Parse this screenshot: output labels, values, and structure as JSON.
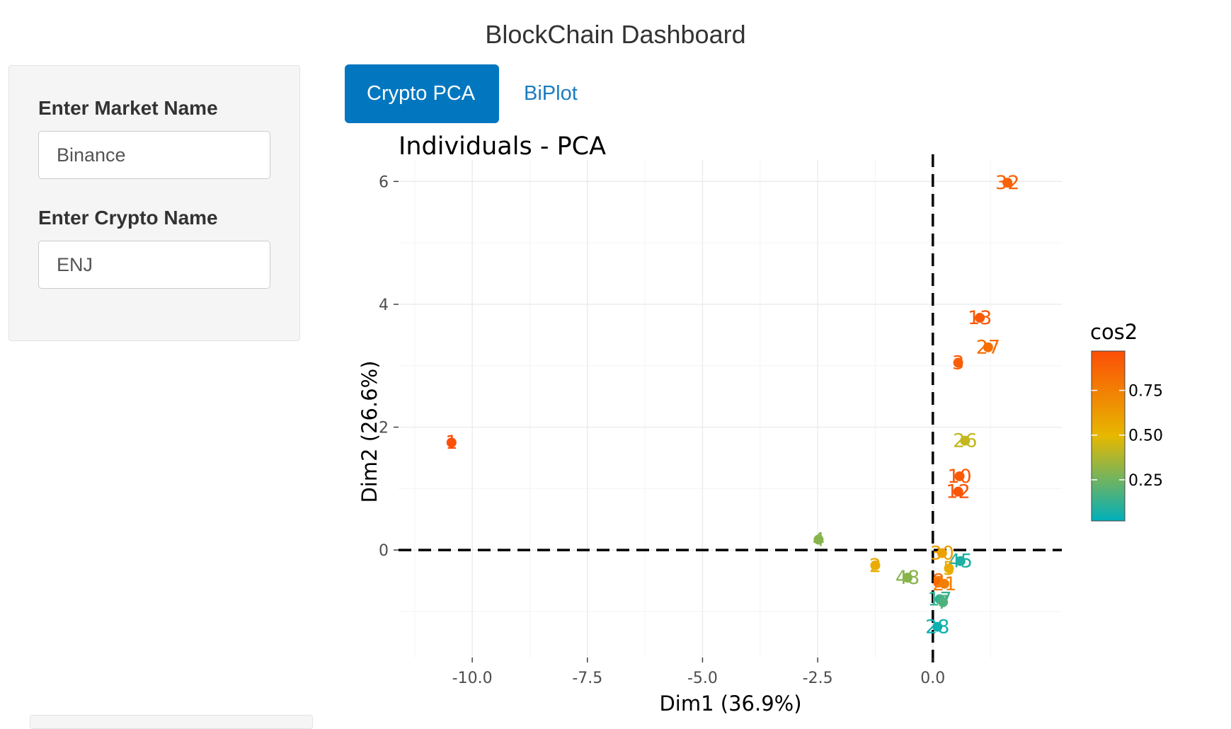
{
  "app": {
    "title": "BlockChain Dashboard"
  },
  "sidebar": {
    "market_label": "Enter Market Name",
    "market_value": "Binance",
    "crypto_label": "Enter Crypto Name",
    "crypto_value": "ENJ"
  },
  "tabs": [
    {
      "label": "Crypto PCA",
      "active": true
    },
    {
      "label": "BiPlot",
      "active": false
    }
  ],
  "chart_data": {
    "type": "scatter",
    "title": "Individuals - PCA",
    "xlabel": "Dim1 (36.9%)",
    "ylabel": "Dim2 (26.6%)",
    "xlim": [
      -11.6,
      2.8
    ],
    "ylim": [
      -1.75,
      6.35
    ],
    "xticks": [
      -10.0,
      -7.5,
      -5.0,
      -2.5,
      0.0
    ],
    "xtick_labels": [
      "-10.0",
      "-7.5",
      "-5.0",
      "-2.5",
      "0.0"
    ],
    "yticks": [
      0,
      2,
      4,
      6
    ],
    "ytick_labels": [
      "0",
      "2",
      "4",
      "6"
    ],
    "grid": true,
    "reference_lines": {
      "x": 0,
      "y": 0,
      "style": "dashed"
    },
    "legend": {
      "title": "cos2",
      "placement": "right",
      "tick_values": [
        0.25,
        0.5,
        0.75
      ],
      "tick_labels": [
        "0.25",
        "0.50",
        "0.75"
      ],
      "range": [
        0.02,
        0.97
      ],
      "colors": [
        "#00AFBB",
        "#E7B800",
        "#FC4E07"
      ]
    },
    "points": [
      {
        "label": "32",
        "x": 1.62,
        "y": 5.98,
        "cos2": 0.88
      },
      {
        "label": "13",
        "x": 1.02,
        "y": 3.78,
        "cos2": 0.93
      },
      {
        "label": "27",
        "x": 1.2,
        "y": 3.3,
        "cos2": 0.82
      },
      {
        "label": "3",
        "x": 0.55,
        "y": 3.05,
        "cos2": 0.9
      },
      {
        "label": "26",
        "x": 0.7,
        "y": 1.78,
        "cos2": 0.42
      },
      {
        "label": "10",
        "x": 0.58,
        "y": 1.2,
        "cos2": 0.92
      },
      {
        "label": "12",
        "x": 0.55,
        "y": 0.95,
        "cos2": 0.94
      },
      {
        "label": "1",
        "x": -10.45,
        "y": 1.75,
        "cos2": 0.96
      },
      {
        "label": "4",
        "x": -2.48,
        "y": 0.17,
        "cos2": 0.3
      },
      {
        "label": "2",
        "x": -1.25,
        "y": -0.25,
        "cos2": 0.55
      },
      {
        "label": "48",
        "x": -0.55,
        "y": -0.45,
        "cos2": 0.3
      },
      {
        "label": "30",
        "x": 0.2,
        "y": -0.05,
        "cos2": 0.6
      },
      {
        "label": "45",
        "x": 0.6,
        "y": -0.18,
        "cos2": 0.08
      },
      {
        "label": "8",
        "x": 0.12,
        "y": -0.5,
        "cos2": 0.85
      },
      {
        "label": "21",
        "x": 0.25,
        "y": -0.55,
        "cos2": 0.75
      },
      {
        "label": "5",
        "x": 0.35,
        "y": -0.3,
        "cos2": 0.55
      },
      {
        "label": "17",
        "x": 0.15,
        "y": -0.8,
        "cos2": 0.12
      },
      {
        "label": "7",
        "x": 0.22,
        "y": -0.85,
        "cos2": 0.18
      },
      {
        "label": "28",
        "x": 0.1,
        "y": -1.25,
        "cos2": 0.05
      }
    ]
  }
}
